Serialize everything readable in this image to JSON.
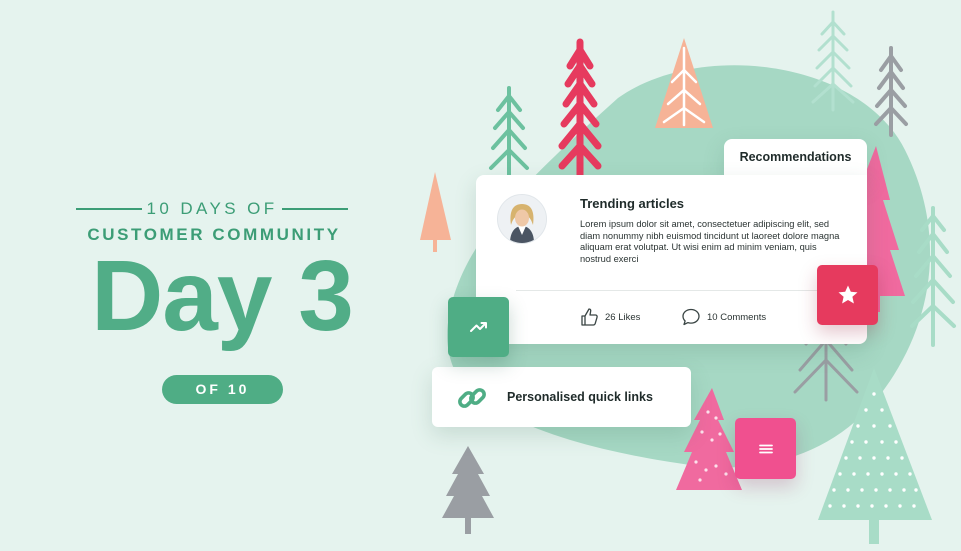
{
  "header": {
    "eyebrow": "10 DAYS OF",
    "subtitle": "CUSTOMER COMMUNITY",
    "day_title": "Day 3",
    "of_label": "OF 10"
  },
  "recommendations": {
    "tab_label": "Recommendations",
    "article": {
      "title": "Trending articles",
      "body": "Lorem ipsum dolor sit amet, consectetuer adipiscing elit, sed diam nonummy nibh euismod tincidunt ut laoreet dolore magna aliquam erat volutpat. Ut wisi enim ad minim veniam, quis nostrud exerci",
      "likes": "26 Likes",
      "comments": "10 Comments"
    }
  },
  "quick_links": {
    "label": "Personalised quick links"
  },
  "icons": {
    "trend": "trending-up-icon",
    "star": "star-icon",
    "menu": "menu-icon",
    "link": "link-icon",
    "like": "thumbs-up-icon",
    "comment": "comment-icon"
  },
  "colors": {
    "background": "#e5f3ee",
    "blob": "#a6d8c4",
    "brand_green": "#4fad85",
    "headline_green": "#51ad87",
    "red": "#e63a5e",
    "pink": "#f0508f",
    "peach": "#f6b397",
    "grey": "#9a9ea3",
    "mint": "#a8dcc7"
  }
}
